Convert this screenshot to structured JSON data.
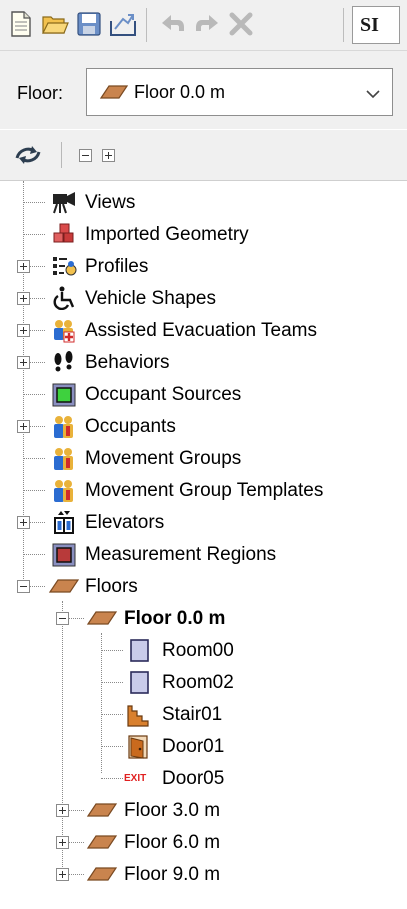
{
  "toolbar": {
    "buttons": [
      {
        "name": "new-file-icon"
      },
      {
        "name": "open-folder-icon"
      },
      {
        "name": "save-icon"
      },
      {
        "name": "import-icon"
      },
      {
        "name": "undo-icon"
      },
      {
        "name": "redo-icon"
      },
      {
        "name": "delete-icon"
      }
    ],
    "units_label": "SI"
  },
  "floor_selector": {
    "label": "Floor:",
    "value": "Floor 0.0 m"
  },
  "tree": {
    "items": [
      {
        "label": "Views",
        "icon": "camera-icon"
      },
      {
        "label": "Imported Geometry",
        "icon": "geometry-icon"
      },
      {
        "label": "Profiles",
        "icon": "profiles-icon",
        "expander": "plus"
      },
      {
        "label": "Vehicle Shapes",
        "icon": "wheelchair-icon",
        "expander": "plus"
      },
      {
        "label": "Assisted Evacuation Teams",
        "icon": "assisted-team-icon",
        "expander": "plus"
      },
      {
        "label": "Behaviors",
        "icon": "footprints-icon",
        "expander": "plus"
      },
      {
        "label": "Occupant Sources",
        "icon": "occupant-source-icon"
      },
      {
        "label": "Occupants",
        "icon": "occupants-icon",
        "expander": "plus"
      },
      {
        "label": "Movement Groups",
        "icon": "movement-groups-icon"
      },
      {
        "label": "Movement Group Templates",
        "icon": "movement-group-templates-icon"
      },
      {
        "label": "Elevators",
        "icon": "elevator-icon",
        "expander": "plus"
      },
      {
        "label": "Measurement Regions",
        "icon": "measurement-region-icon"
      },
      {
        "label": "Floors",
        "icon": "floor-icon",
        "expander": "minus"
      },
      {
        "label": "Floor 0.0 m",
        "icon": "floor-icon",
        "expander": "minus",
        "bold": true
      },
      {
        "label": "Room00",
        "icon": "room-icon"
      },
      {
        "label": "Room02",
        "icon": "room-icon"
      },
      {
        "label": "Stair01",
        "icon": "stair-icon"
      },
      {
        "label": "Door01",
        "icon": "door-icon"
      },
      {
        "label": "Door05",
        "icon": "exit-icon",
        "icon_text": "EXIT"
      },
      {
        "label": "Floor 3.0 m",
        "icon": "floor-icon",
        "expander": "plus"
      },
      {
        "label": "Floor 6.0 m",
        "icon": "floor-icon",
        "expander": "plus"
      },
      {
        "label": "Floor 9.0 m",
        "icon": "floor-icon",
        "expander": "plus"
      }
    ]
  }
}
